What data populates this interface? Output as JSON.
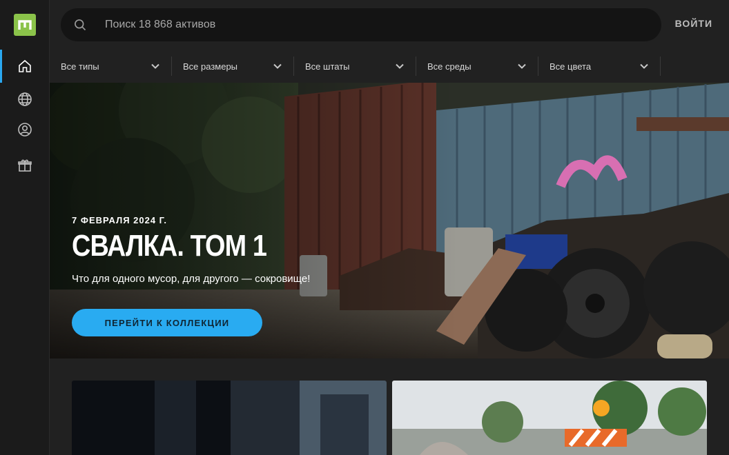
{
  "app": {
    "logo_icon": "m-logo-icon",
    "accent_color": "#8bc34a",
    "highlight_color": "#2aa8f0"
  },
  "sidebar": {
    "items": [
      {
        "icon": "home-icon",
        "active": true
      },
      {
        "icon": "globe-icon",
        "active": false
      },
      {
        "icon": "user-circle-icon",
        "active": false
      },
      {
        "icon": "gift-icon",
        "active": false
      }
    ]
  },
  "header": {
    "search_placeholder": "Поиск 18 868 активов",
    "login_label": "ВОЙТИ"
  },
  "filters": [
    {
      "label": "Все типы"
    },
    {
      "label": "Все размеры"
    },
    {
      "label": "Все штаты"
    },
    {
      "label": "Все среды"
    },
    {
      "label": "Все цвета"
    }
  ],
  "hero": {
    "date": "7 ФЕВРАЛЯ 2024 Г.",
    "title": "СВАЛКА. ТОМ 1",
    "subtitle": "Что для одного мусор, для другого — сокровище!",
    "button_label": "ПЕРЕЙТИ К КОЛЛЕКЦИИ",
    "button_color": "#29abf1"
  },
  "cards": [
    {
      "name": "collection-card-dark-metal"
    },
    {
      "name": "collection-card-road-barrier"
    }
  ]
}
